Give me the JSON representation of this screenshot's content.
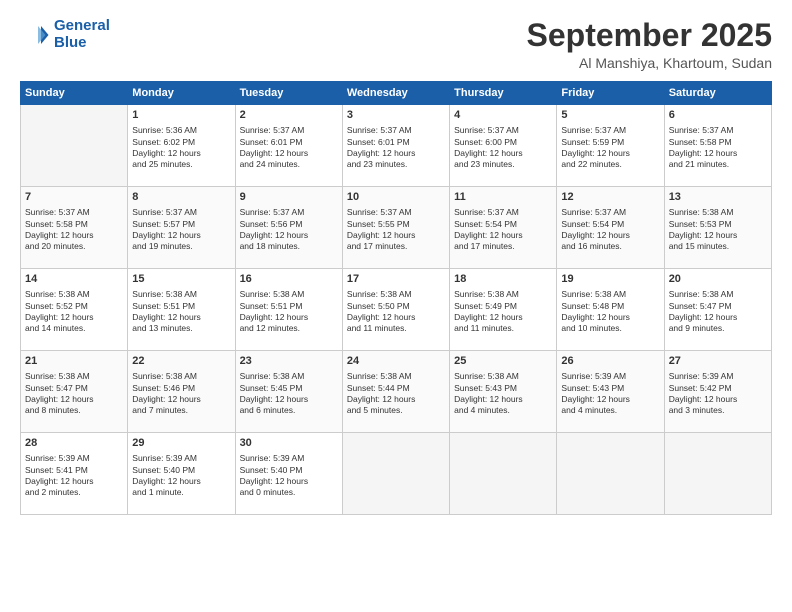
{
  "header": {
    "logo_line1": "General",
    "logo_line2": "Blue",
    "month": "September 2025",
    "location": "Al Manshiya, Khartoum, Sudan"
  },
  "days_of_week": [
    "Sunday",
    "Monday",
    "Tuesday",
    "Wednesday",
    "Thursday",
    "Friday",
    "Saturday"
  ],
  "weeks": [
    [
      {
        "day": "",
        "info": ""
      },
      {
        "day": "1",
        "info": "Sunrise: 5:36 AM\nSunset: 6:02 PM\nDaylight: 12 hours\nand 25 minutes."
      },
      {
        "day": "2",
        "info": "Sunrise: 5:37 AM\nSunset: 6:01 PM\nDaylight: 12 hours\nand 24 minutes."
      },
      {
        "day": "3",
        "info": "Sunrise: 5:37 AM\nSunset: 6:01 PM\nDaylight: 12 hours\nand 23 minutes."
      },
      {
        "day": "4",
        "info": "Sunrise: 5:37 AM\nSunset: 6:00 PM\nDaylight: 12 hours\nand 23 minutes."
      },
      {
        "day": "5",
        "info": "Sunrise: 5:37 AM\nSunset: 5:59 PM\nDaylight: 12 hours\nand 22 minutes."
      },
      {
        "day": "6",
        "info": "Sunrise: 5:37 AM\nSunset: 5:58 PM\nDaylight: 12 hours\nand 21 minutes."
      }
    ],
    [
      {
        "day": "7",
        "info": "Sunrise: 5:37 AM\nSunset: 5:58 PM\nDaylight: 12 hours\nand 20 minutes."
      },
      {
        "day": "8",
        "info": "Sunrise: 5:37 AM\nSunset: 5:57 PM\nDaylight: 12 hours\nand 19 minutes."
      },
      {
        "day": "9",
        "info": "Sunrise: 5:37 AM\nSunset: 5:56 PM\nDaylight: 12 hours\nand 18 minutes."
      },
      {
        "day": "10",
        "info": "Sunrise: 5:37 AM\nSunset: 5:55 PM\nDaylight: 12 hours\nand 17 minutes."
      },
      {
        "day": "11",
        "info": "Sunrise: 5:37 AM\nSunset: 5:54 PM\nDaylight: 12 hours\nand 17 minutes."
      },
      {
        "day": "12",
        "info": "Sunrise: 5:37 AM\nSunset: 5:54 PM\nDaylight: 12 hours\nand 16 minutes."
      },
      {
        "day": "13",
        "info": "Sunrise: 5:38 AM\nSunset: 5:53 PM\nDaylight: 12 hours\nand 15 minutes."
      }
    ],
    [
      {
        "day": "14",
        "info": "Sunrise: 5:38 AM\nSunset: 5:52 PM\nDaylight: 12 hours\nand 14 minutes."
      },
      {
        "day": "15",
        "info": "Sunrise: 5:38 AM\nSunset: 5:51 PM\nDaylight: 12 hours\nand 13 minutes."
      },
      {
        "day": "16",
        "info": "Sunrise: 5:38 AM\nSunset: 5:51 PM\nDaylight: 12 hours\nand 12 minutes."
      },
      {
        "day": "17",
        "info": "Sunrise: 5:38 AM\nSunset: 5:50 PM\nDaylight: 12 hours\nand 11 minutes."
      },
      {
        "day": "18",
        "info": "Sunrise: 5:38 AM\nSunset: 5:49 PM\nDaylight: 12 hours\nand 11 minutes."
      },
      {
        "day": "19",
        "info": "Sunrise: 5:38 AM\nSunset: 5:48 PM\nDaylight: 12 hours\nand 10 minutes."
      },
      {
        "day": "20",
        "info": "Sunrise: 5:38 AM\nSunset: 5:47 PM\nDaylight: 12 hours\nand 9 minutes."
      }
    ],
    [
      {
        "day": "21",
        "info": "Sunrise: 5:38 AM\nSunset: 5:47 PM\nDaylight: 12 hours\nand 8 minutes."
      },
      {
        "day": "22",
        "info": "Sunrise: 5:38 AM\nSunset: 5:46 PM\nDaylight: 12 hours\nand 7 minutes."
      },
      {
        "day": "23",
        "info": "Sunrise: 5:38 AM\nSunset: 5:45 PM\nDaylight: 12 hours\nand 6 minutes."
      },
      {
        "day": "24",
        "info": "Sunrise: 5:38 AM\nSunset: 5:44 PM\nDaylight: 12 hours\nand 5 minutes."
      },
      {
        "day": "25",
        "info": "Sunrise: 5:38 AM\nSunset: 5:43 PM\nDaylight: 12 hours\nand 4 minutes."
      },
      {
        "day": "26",
        "info": "Sunrise: 5:39 AM\nSunset: 5:43 PM\nDaylight: 12 hours\nand 4 minutes."
      },
      {
        "day": "27",
        "info": "Sunrise: 5:39 AM\nSunset: 5:42 PM\nDaylight: 12 hours\nand 3 minutes."
      }
    ],
    [
      {
        "day": "28",
        "info": "Sunrise: 5:39 AM\nSunset: 5:41 PM\nDaylight: 12 hours\nand 2 minutes."
      },
      {
        "day": "29",
        "info": "Sunrise: 5:39 AM\nSunset: 5:40 PM\nDaylight: 12 hours\nand 1 minute."
      },
      {
        "day": "30",
        "info": "Sunrise: 5:39 AM\nSunset: 5:40 PM\nDaylight: 12 hours\nand 0 minutes."
      },
      {
        "day": "",
        "info": ""
      },
      {
        "day": "",
        "info": ""
      },
      {
        "day": "",
        "info": ""
      },
      {
        "day": "",
        "info": ""
      }
    ]
  ]
}
